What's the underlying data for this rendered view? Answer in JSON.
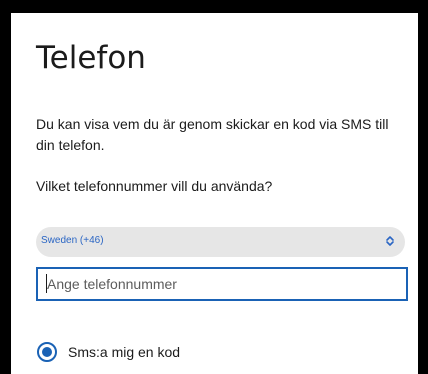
{
  "page": {
    "title": "Telefon",
    "description": "Du kan visa vem du är genom skickar en kod via SMS till din telefon.",
    "question": "Vilket telefonnummer vill du använda?"
  },
  "country_select": {
    "selected": "Sweden (+46)"
  },
  "phone_input": {
    "placeholder": "Ange telefonnummer",
    "value": ""
  },
  "method_option": {
    "label": "Sms:a mig en kod",
    "selected": true
  },
  "colors": {
    "accent": "#1a62b5",
    "select_text": "#2b66c4",
    "select_bg": "#e6e6e6",
    "frame": "#000000"
  },
  "icons": {
    "select_arrows": "chevron-up-down-icon",
    "radio": "radio-selected-icon"
  }
}
